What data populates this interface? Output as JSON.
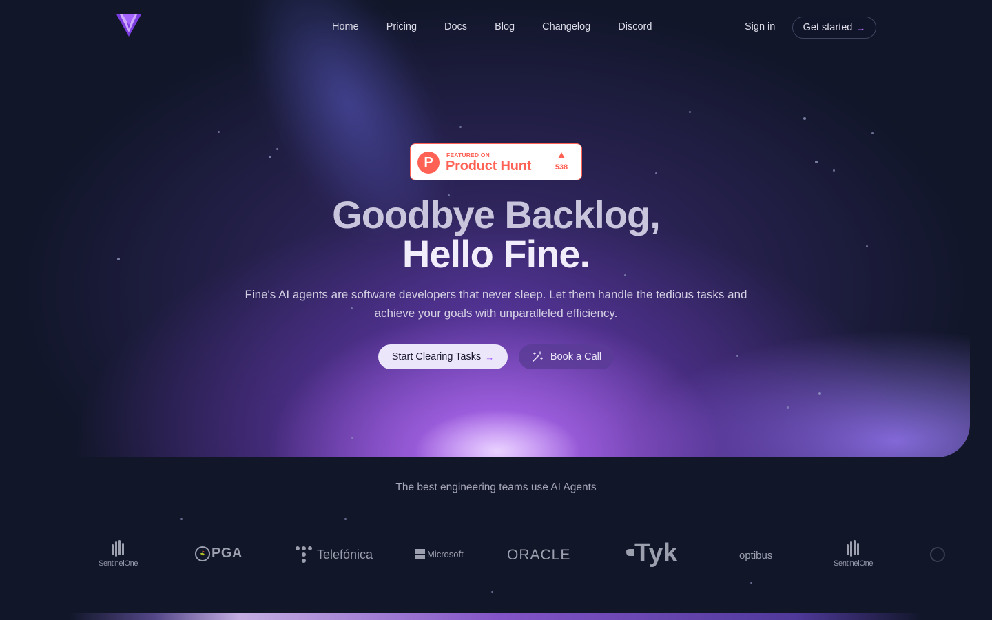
{
  "nav": {
    "links": [
      "Home",
      "Pricing",
      "Docs",
      "Blog",
      "Changelog",
      "Discord"
    ],
    "sign_in": "Sign in",
    "get_started": "Get started",
    "arrow": "→"
  },
  "product_hunt": {
    "featured_on": "FEATURED ON",
    "name": "Product Hunt",
    "logo_letter": "P",
    "upvotes": "538"
  },
  "hero": {
    "headline_line1": "Goodbye Backlog,",
    "headline_line2": "Hello Fine.",
    "subtitle": "Fine's AI agents are software developers that never sleep. Let them handle the tedious tasks and achieve your goals with unparalleled efficiency.",
    "cta_primary": "Start Clearing Tasks",
    "cta_secondary": "Book a Call"
  },
  "customers": {
    "caption": "The best engineering teams use AI Agents",
    "logos": [
      "SentinelOne",
      "PGA",
      "Telefónica",
      "Microsoft",
      "ORACLE",
      "Tyk",
      "optibus",
      "SentinelOne"
    ]
  },
  "colors": {
    "background": "#111629",
    "accent": "#b36dff",
    "product_hunt": "#ff6154"
  },
  "icons": {
    "logo": "fine-logo-triangle",
    "arrow": "arrow-right-icon",
    "wand": "magic-wand-icon",
    "upvote": "triangle-up-icon"
  }
}
